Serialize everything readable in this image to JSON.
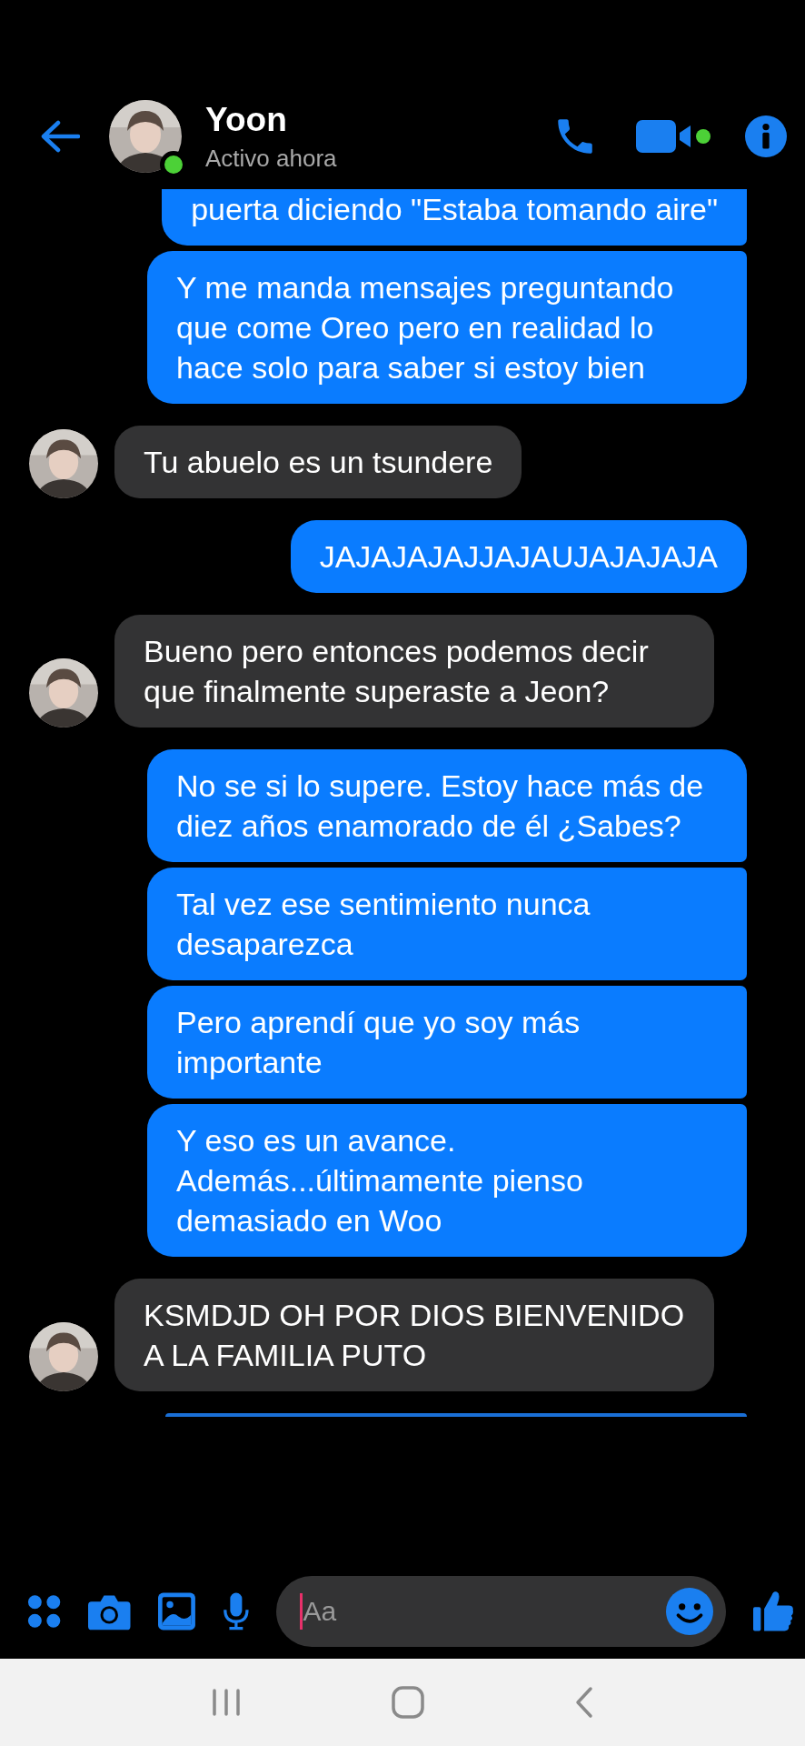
{
  "header": {
    "name": "Yoon",
    "status": "Activo ahora",
    "online": true
  },
  "groups": [
    {
      "kind": "sent",
      "messages": [
        "puerta diciendo \"Estaba tomando aire\"",
        "Y me manda mensajes preguntando que come Oreo pero en realidad lo hace solo para saber si estoy bien"
      ]
    },
    {
      "kind": "received",
      "messages": [
        "Tu abuelo es un tsundere"
      ]
    },
    {
      "kind": "sent",
      "messages": [
        "JAJAJAJAJJAJAUJAJAJAJA"
      ]
    },
    {
      "kind": "received",
      "messages": [
        "Bueno pero entonces podemos decir que finalmente superaste a Jeon?"
      ]
    },
    {
      "kind": "sent",
      "messages": [
        "No se si lo supere. Estoy hace más de diez años enamorado de él ¿Sabes?",
        "Tal vez ese sentimiento nunca desaparezca",
        "Pero aprendí que yo soy más importante",
        "Y eso es un avance. Además...últimamente pienso demasiado en Woo"
      ]
    },
    {
      "kind": "received",
      "messages": [
        "KSMDJD OH POR DIOS BIENVENIDO A LA FAMILIA PUTO"
      ]
    }
  ],
  "composer": {
    "placeholder": "Aa"
  }
}
